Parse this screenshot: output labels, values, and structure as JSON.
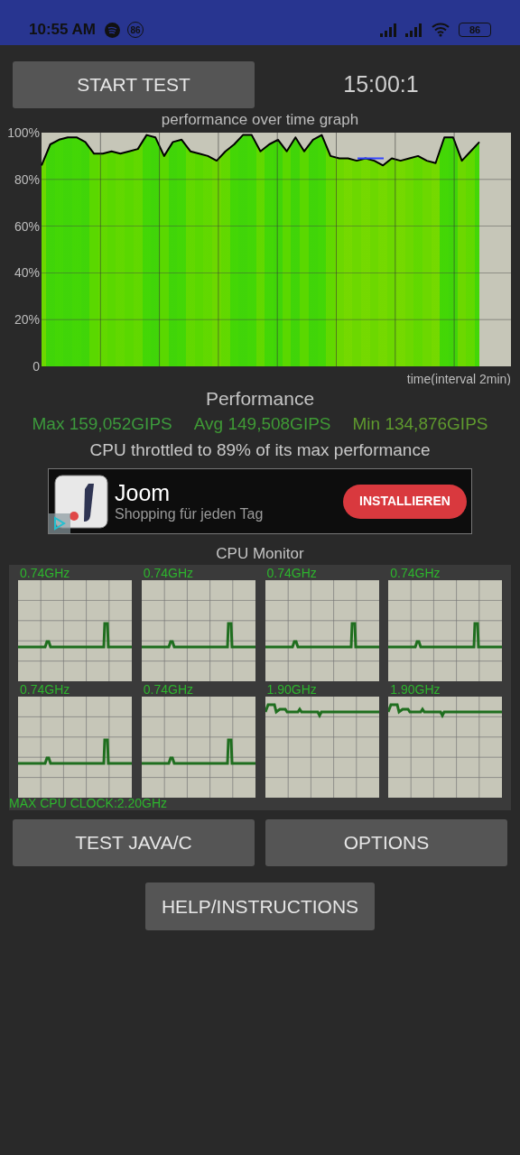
{
  "status_bar": {
    "time": "10:55 AM",
    "notification_badge": "86",
    "battery": "86"
  },
  "start_button": "START TEST",
  "timer": "15:00:1",
  "graph": {
    "chart_data": {
      "type": "area",
      "title": "performance over time graph",
      "grid": true,
      "categories": [
        null,
        null,
        null,
        null,
        null,
        null,
        null,
        null,
        null,
        null,
        null,
        null,
        null,
        null,
        null,
        null,
        null,
        null,
        null,
        null,
        null,
        null,
        null,
        null,
        null,
        null,
        null,
        null,
        null,
        null,
        null,
        null,
        null,
        null,
        null,
        null,
        null,
        null,
        null,
        null,
        null,
        null,
        null,
        null,
        null,
        null,
        null,
        null,
        null,
        null,
        null
      ],
      "xlabel": "time(interval 2min)",
      "ylim": [
        0,
        100
      ],
      "yticks": [
        {
          "value": 0,
          "label": "0"
        },
        {
          "value": 20,
          "label": "20%"
        },
        {
          "value": 40,
          "label": "40%"
        },
        {
          "value": 60,
          "label": "60%"
        },
        {
          "value": 80,
          "label": "80%"
        },
        {
          "value": 100,
          "label": "100%"
        }
      ],
      "series": [
        {
          "color": "#5ad800",
          "values": [
            86,
            95,
            97,
            98,
            98,
            96,
            91,
            91,
            92,
            91,
            92,
            93,
            99,
            98,
            90,
            96,
            97,
            92,
            91,
            90,
            88,
            92,
            95,
            99,
            99,
            92,
            95,
            97,
            92,
            98,
            92,
            97,
            99,
            90,
            89,
            89,
            88,
            89,
            88,
            86,
            89,
            88,
            89,
            90,
            88,
            87,
            98,
            98,
            88,
            92,
            96
          ]
        }
      ]
    }
  },
  "performance": {
    "title": "Performance",
    "stats": [
      {
        "text": "Max 159,052GIPS",
        "color": "#3c9a3c"
      },
      {
        "text": "Avg 149,508GIPS",
        "color": "#3f9a35"
      },
      {
        "text": "Min 134,876GIPS",
        "color": "#5f9a2e"
      }
    ],
    "message": "CPU throttled to 89% of its max performance"
  },
  "ad": {
    "title": "Joom",
    "subtitle": "Shopping für jeden Tag",
    "button": "INSTALLIEREN"
  },
  "cpu_monitor": {
    "title": "CPU Monitor",
    "cores": [
      {
        "freq": "0.74GHz",
        "kind": "idle"
      },
      {
        "freq": "0.74GHz",
        "kind": "idle"
      },
      {
        "freq": "0.74GHz",
        "kind": "idle"
      },
      {
        "freq": "0.74GHz",
        "kind": "idle"
      },
      {
        "freq": "0.74GHz",
        "kind": "idle"
      },
      {
        "freq": "0.74GHz",
        "kind": "idle"
      },
      {
        "freq": "1.90GHz",
        "kind": "busy"
      },
      {
        "freq": "1.90GHz",
        "kind": "busy"
      }
    ],
    "max_clock": "MAX CPU CLOCK:2.20GHz"
  },
  "buttons": [
    "TEST JAVA/C",
    "OPTIONS"
  ],
  "help_button": "HELP/INSTRUCTIONS"
}
